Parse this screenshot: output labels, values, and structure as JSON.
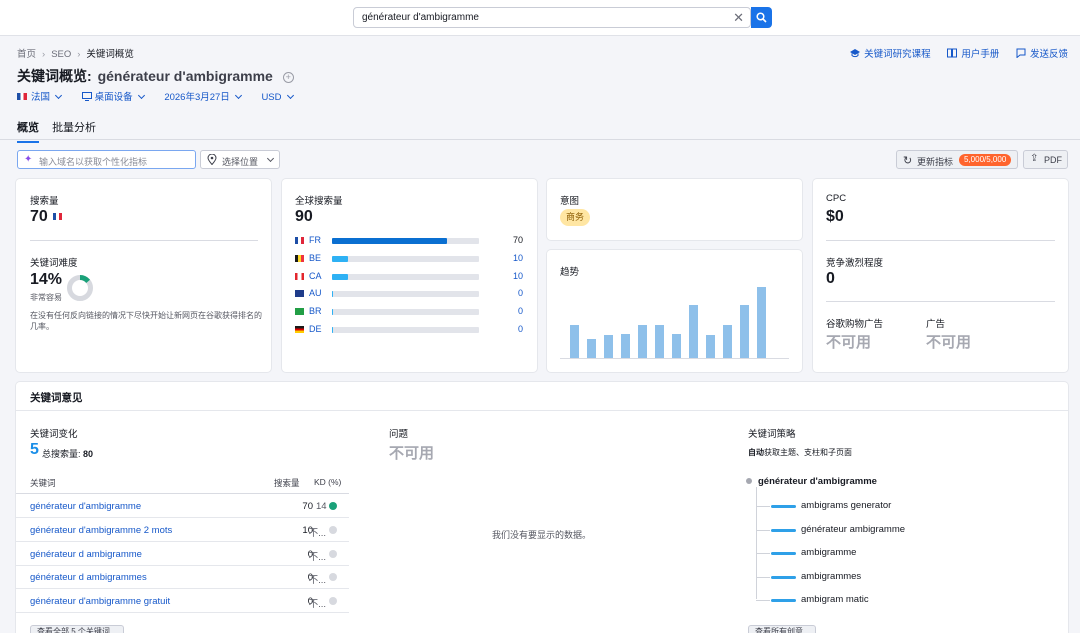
{
  "search": {
    "query": "générateur d'ambigramme",
    "clear_icon": "close-icon",
    "button_icon": "search-icon"
  },
  "breadcrumb": [
    "首页",
    "SEO",
    "关键词概览"
  ],
  "header_links": [
    {
      "label": "关键词研究课程",
      "icon": "graduation-cap-icon"
    },
    {
      "label": "用户手册",
      "icon": "book-icon"
    },
    {
      "label": "发送反馈",
      "icon": "comment-icon"
    }
  ],
  "title": {
    "prefix": "关键词概览:",
    "keyword": "générateur d'ambigramme"
  },
  "filters": {
    "country": "法国",
    "device": "桌面设备",
    "date": "2026年3月27日",
    "currency": "USD"
  },
  "tabs": [
    {
      "label": "概览",
      "active": true
    },
    {
      "label": "批量分析",
      "active": false
    }
  ],
  "toolbar": {
    "domain_placeholder": "输入域名以获取个性化指标",
    "location_placeholder": "选择位置",
    "update_label": "更新指标",
    "update_badge": "5,000/5,000",
    "pdf_label": "PDF"
  },
  "volume_card": {
    "label": "搜索量",
    "value": "70",
    "kd_label": "关键词难度",
    "kd_value": "14%",
    "kd_percent": 14,
    "kd_level": "非常容易",
    "kd_desc": "在没有任何反向链接的情况下尽快开始让新网页在谷歌获得排名的几率。"
  },
  "global_card": {
    "label": "全球搜索量",
    "value": "90",
    "countries": [
      {
        "code": "FR",
        "value": 70
      },
      {
        "code": "BE",
        "value": 10
      },
      {
        "code": "CA",
        "value": 10
      },
      {
        "code": "AU",
        "value": 0
      },
      {
        "code": "BR",
        "value": 0
      },
      {
        "code": "DE",
        "value": 0
      }
    ]
  },
  "intent_card": {
    "label": "意图",
    "badge": "商务"
  },
  "trend_card": {
    "label": "趋势",
    "values": [
      0.46,
      0.27,
      0.33,
      0.34,
      0.47,
      0.47,
      0.34,
      0.75,
      0.33,
      0.47,
      0.75,
      1.0
    ]
  },
  "cpc_card": {
    "label": "CPC",
    "value": "$0",
    "competition_label": "竞争激烈程度",
    "competition_value": "0",
    "shopping_label": "谷歌购物广告",
    "shopping_value": "不可用",
    "ads_label": "广告",
    "ads_value": "不可用"
  },
  "ideas": {
    "title": "关键词意见",
    "variations_label": "关键词变化",
    "variations_count": "5",
    "total_volume_label": "总搜索量:",
    "total_volume": "80",
    "col_keyword": "关键词",
    "col_volume": "搜索量",
    "col_kd": "KD (%)",
    "rows": [
      {
        "keyword": "générateur d'ambigramme",
        "volume": "70",
        "kd": "14",
        "dot": "#1aa179"
      },
      {
        "keyword": "générateur d'ambigramme 2 mots",
        "volume": "10",
        "kd": "不...",
        "dot": "#d7d9df"
      },
      {
        "keyword": "générateur d ambigramme",
        "volume": "0",
        "kd": "不...",
        "dot": "#d7d9df"
      },
      {
        "keyword": "générateur d ambigrammes",
        "volume": "0",
        "kd": "不...",
        "dot": "#d7d9df"
      },
      {
        "keyword": "générateur d'ambigramme gratuit",
        "volume": "0",
        "kd": "不...",
        "dot": "#d7d9df"
      }
    ],
    "view_all": "查看全部 5 个关键词",
    "questions_label": "问题",
    "questions_value": "不可用",
    "no_data": "我们没有要显示的数据。",
    "strategy_label": "关键词策略",
    "strategy_bold": "自动",
    "strategy_rest": "获取主题、支柱和子页面",
    "root": "générateur d'ambigramme",
    "children": [
      "ambigrams generator",
      "générateur ambigramme",
      "ambigramme",
      "ambigrammes",
      "ambigram matic"
    ],
    "view_strategy": "查看所有创意"
  },
  "colors": {
    "accent": "#1a73e8",
    "bar_fr": "#0a6fd1",
    "bar_other": "#2eb1f4",
    "kd_ring": "#1aa179"
  }
}
